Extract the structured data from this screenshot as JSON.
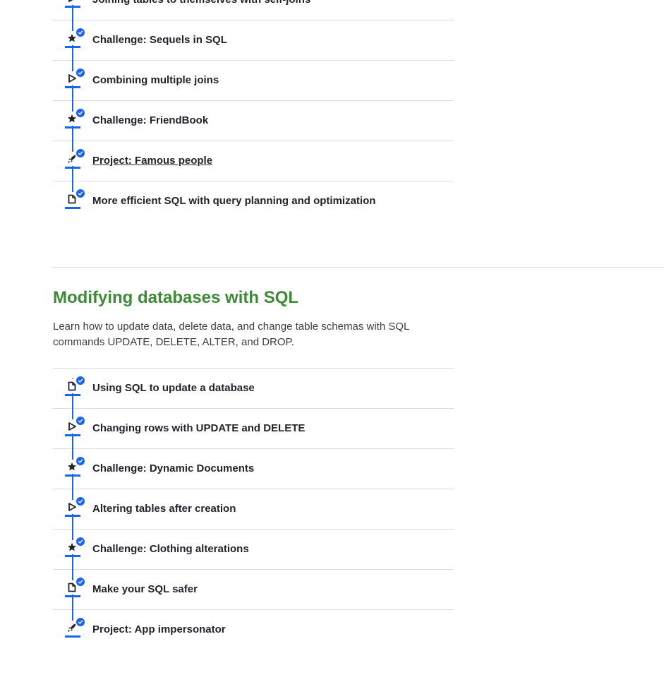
{
  "colors": {
    "accent": "#1865f2",
    "unit_title": "#3d8b37",
    "text": "#21242c",
    "divider": "#dadce0"
  },
  "previous_unit": {
    "items": [
      {
        "label": "Joining tables to themselves with self-joins",
        "icon": "play-icon",
        "completed": true
      },
      {
        "label": "Challenge: Sequels in SQL",
        "icon": "star-icon",
        "completed": true
      },
      {
        "label": "Combining multiple joins",
        "icon": "play-icon",
        "completed": true
      },
      {
        "label": "Challenge: FriendBook",
        "icon": "star-icon",
        "completed": true
      },
      {
        "label": "Project: Famous people",
        "icon": "rocket-icon",
        "completed": true,
        "underlined": true
      },
      {
        "label": "More efficient SQL with query planning and optimization",
        "icon": "article-icon",
        "completed": true
      }
    ]
  },
  "unit": {
    "title": "Modifying databases with SQL",
    "description": "Learn how to update data, delete data, and change table schemas with SQL commands UPDATE, DELETE, ALTER, and DROP.",
    "items": [
      {
        "label": "Using SQL to update a database",
        "icon": "article-icon",
        "completed": true
      },
      {
        "label": "Changing rows with UPDATE and DELETE",
        "icon": "play-icon",
        "completed": true
      },
      {
        "label": "Challenge: Dynamic Documents",
        "icon": "star-icon",
        "completed": true
      },
      {
        "label": "Altering tables after creation",
        "icon": "play-icon",
        "completed": true
      },
      {
        "label": "Challenge: Clothing alterations",
        "icon": "star-icon",
        "completed": true
      },
      {
        "label": "Make your SQL safer",
        "icon": "article-icon",
        "completed": true
      },
      {
        "label": "Project: App impersonator",
        "icon": "rocket-icon",
        "completed": true
      }
    ]
  }
}
